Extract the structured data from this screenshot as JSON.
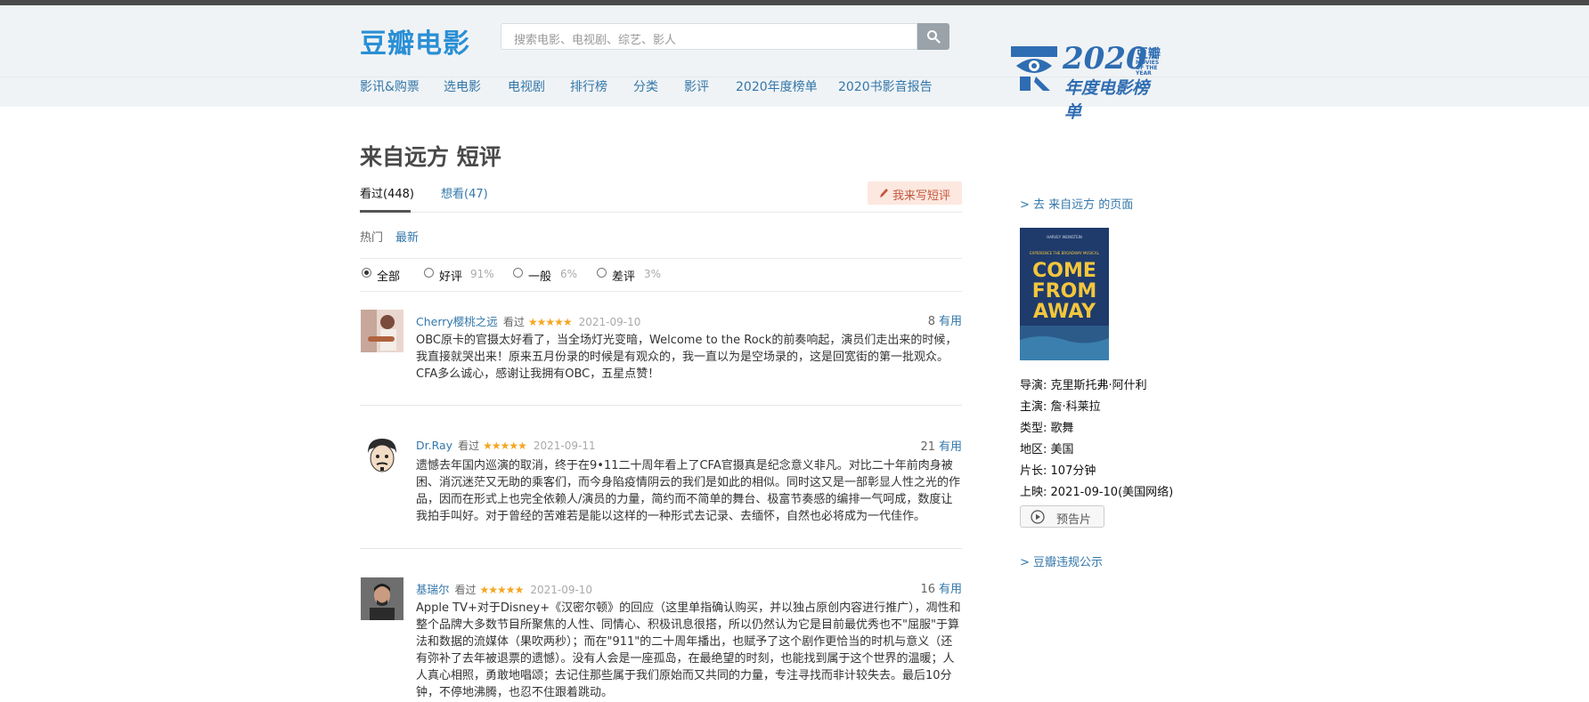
{
  "header": {
    "logo": "豆瓣电影",
    "search_placeholder": "搜索电影、电视剧、综艺、影人",
    "nav": [
      "影讯&购票",
      "选电影",
      "电视剧",
      "排行榜",
      "分类",
      "影评",
      "2020年度榜单",
      "2020书影音报告"
    ],
    "badge": {
      "year": "2020",
      "brand": "豆瓣",
      "mini": "MOVIES OF THE YEAR",
      "subtitle": "年度电影榜单"
    }
  },
  "page": {
    "title": "来自远方 短评",
    "tabs": [
      {
        "label": "看过(448)",
        "active": true
      },
      {
        "label": "想看(47)",
        "active": false
      }
    ],
    "write_button": "我来写短评",
    "sort": [
      "热门",
      "最新"
    ],
    "filters": [
      {
        "label": "全部",
        "pct": "",
        "checked": true
      },
      {
        "label": "好评",
        "pct": "91%",
        "checked": false
      },
      {
        "label": "一般",
        "pct": "6%",
        "checked": false
      },
      {
        "label": "差评",
        "pct": "3%",
        "checked": false
      }
    ]
  },
  "reviews": [
    {
      "user": "Cherry樱桃之远",
      "status": "看过",
      "stars": 5,
      "date": "2021-09-10",
      "votes": "8",
      "useful": "有用",
      "text": "OBC原卡的官摄太好看了，当全场灯光变暗，Welcome to the Rock的前奏响起，演员们走出来的时候，我直接就哭出来！原来五月份录的时候是有观众的，我一直以为是空场录的，这是回宽街的第一批观众。CFA多么诚心，感谢让我拥有OBC，五星点赞！"
    },
    {
      "user": "Dr.Ray",
      "status": "看过",
      "stars": 5,
      "date": "2021-09-11",
      "votes": "21",
      "useful": "有用",
      "text": "遗憾去年国内巡演的取消，终于在9•11二十周年看上了CFA官摄真是纪念意义非凡。对比二十年前肉身被困、消沉迷茫又无助的乘客们，而今身陷疫情阴云的我们是如此的相似。同时这又是一部彰显人性之光的作品，因而在形式上也完全依赖人/演员的力量，简约而不简单的舞台、极富节奏感的编排一气呵成，数度让我拍手叫好。对于曾经的苦难若是能以这样的一种形式去记录、去缅怀，自然也必将成为一代佳作。"
    },
    {
      "user": "基瑞尔",
      "status": "看过",
      "stars": 5,
      "date": "2021-09-10",
      "votes": "16",
      "useful": "有用",
      "text": "Apple TV+对于Disney+《汉密尔顿》的回应（这里单指确认购买，并以独占原创内容进行推广），凋性和整个品牌大多数节目所聚焦的人性、同情心、积极讯息很搭，所以仍然认为它是目前最优秀也不\"屈服\"于算法和数据的流媒体（果吹两秒）；而在\"911\"的二十周年播出，也赋予了这个剧作更恰当的时机与意义（还有弥补了去年被退票的遗憾）。没有人会是一座孤岛，在最绝望的时刻，也能找到属于这个世界的温暖；人人真心相照，勇敢地唱颂；去记住那些属于我们原始而又共同的力量，专注寻找而非计较失去。最后10分钟，不停地沸腾，也忍不住跟着跳动。"
    }
  ],
  "sidebar": {
    "movie_link": "> 去 来自远方 的页面",
    "poster": {
      "top_text": "HARVEY WEINSTEIN",
      "small_text": "EXPERIENCE THE BROADWAY MUSICAL",
      "title_lines": [
        "COME",
        "FROM",
        "AWAY"
      ]
    },
    "info": [
      {
        "key": "导演:",
        "value": "克里斯托弗·阿什利"
      },
      {
        "key": "主演:",
        "value": "詹·科莱拉"
      },
      {
        "key": "类型:",
        "value": "歌舞"
      },
      {
        "key": "地区:",
        "value": "美国"
      },
      {
        "key": "片长:",
        "value": "107分钟"
      },
      {
        "key": "上映:",
        "value": "2021-09-10(美国网络)"
      }
    ],
    "trailer": "预告片",
    "report_link": "> 豆瓣违规公示"
  },
  "colors": {
    "link": "#3377aa",
    "star": "#f5a623",
    "header_bg": "#f0f3f5",
    "logo": "#2a8fd5"
  }
}
